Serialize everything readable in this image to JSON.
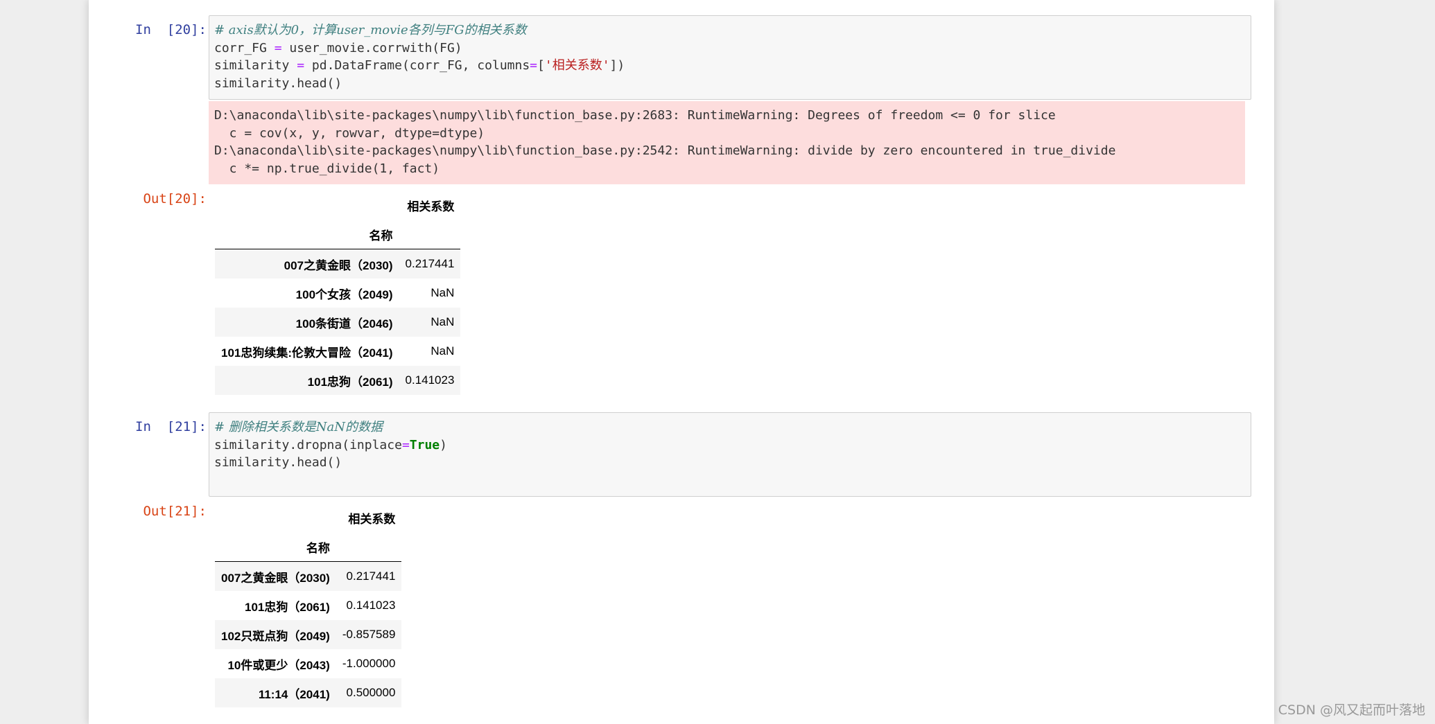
{
  "cells": {
    "in20": {
      "prompt": "In  [20]:",
      "line1": "# axis默认为0，计算user_movie各列与FG的相关系数",
      "line2_a": "corr_FG ",
      "line2_op": "=",
      "line2_b": " user_movie.corrwith(FG)",
      "line3_a": "similarity ",
      "line3_op": "=",
      "line3_b": " pd.DataFrame(corr_FG, columns",
      "line3_op2": "=",
      "line3_c": "[",
      "line3_str": "'相关系数'",
      "line3_d": "])",
      "line4": "similarity.head()"
    },
    "stderr": {
      "line1": "D:\\anaconda\\lib\\site-packages\\numpy\\lib\\function_base.py:2683: RuntimeWarning: Degrees of freedom <= 0 for slice",
      "line2": "  c = cov(x, y, rowvar, dtype=dtype)",
      "line3": "D:\\anaconda\\lib\\site-packages\\numpy\\lib\\function_base.py:2542: RuntimeWarning: divide by zero encountered in true_divide",
      "line4": "  c *= np.true_divide(1, fact)"
    },
    "out20": {
      "prompt": "Out[20]:",
      "column": "相关系数",
      "index_name": "名称",
      "rows": [
        {
          "name": "007之黄金眼（2030)",
          "value": "0.217441"
        },
        {
          "name": "100个女孩（2049)",
          "value": "NaN"
        },
        {
          "name": "100条街道（2046)",
          "value": "NaN"
        },
        {
          "name": "101忠狗续集:伦敦大冒险（2041)",
          "value": "NaN"
        },
        {
          "name": "101忠狗（2061)",
          "value": "0.141023"
        }
      ]
    },
    "in21": {
      "prompt": "In  [21]:",
      "line1": "# 删除相关系数是NaN的数据",
      "line2_a": "similarity.dropna(inplace",
      "line2_op": "=",
      "line2_kw": "True",
      "line2_b": ")",
      "line3": "similarity.head()"
    },
    "out21": {
      "prompt": "Out[21]:",
      "column": "相关系数",
      "index_name": "名称",
      "rows": [
        {
          "name": "007之黄金眼（2030)",
          "value": "0.217441"
        },
        {
          "name": "101忠狗（2061)",
          "value": "0.141023"
        },
        {
          "name": "102只斑点狗（2049)",
          "value": "-0.857589"
        },
        {
          "name": "10件或更少（2043)",
          "value": "-1.000000"
        },
        {
          "name": "11:14（2041)",
          "value": "0.500000"
        }
      ]
    }
  },
  "watermark": "CSDN @风又起而叶落地"
}
